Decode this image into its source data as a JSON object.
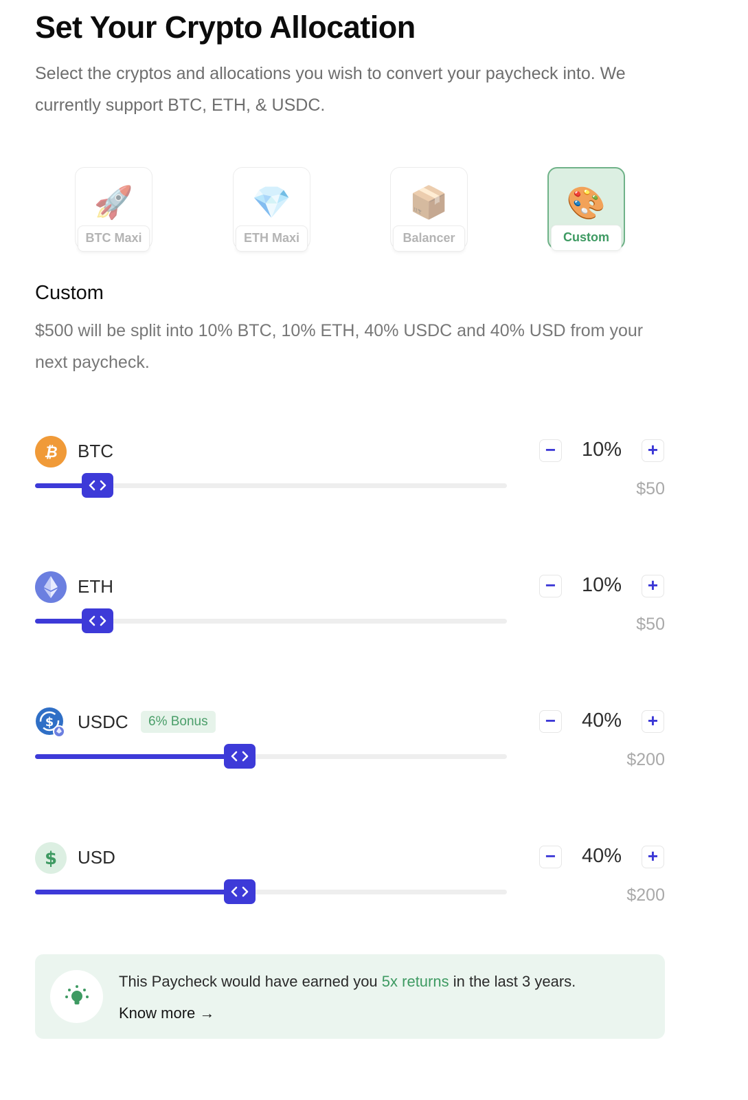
{
  "header": {
    "title": "Set Your Crypto Allocation",
    "subtitle": "Select the cryptos and allocations you wish to convert your paycheck into. We currently support BTC, ETH, & USDC."
  },
  "presets": [
    {
      "label": "BTC Maxi",
      "icon": "rocket-icon",
      "glyph": "🚀",
      "selected": false
    },
    {
      "label": "ETH Maxi",
      "icon": "gem-icon",
      "glyph": "💎",
      "selected": false
    },
    {
      "label": "Balancer",
      "icon": "package-icon",
      "glyph": "📦",
      "selected": false
    },
    {
      "label": "Custom",
      "icon": "palette-icon",
      "glyph": "🎨",
      "selected": true
    }
  ],
  "selection": {
    "title": "Custom",
    "description": "$500 will be split into 10% BTC, 10% ETH, 40% USDC and 40% USD from your next paycheck."
  },
  "assets": [
    {
      "name": "BTC",
      "icon": "bitcoin-icon",
      "percent": 10,
      "percent_label": "10%",
      "amount": "$50",
      "badge": null
    },
    {
      "name": "ETH",
      "icon": "ethereum-icon",
      "percent": 10,
      "percent_label": "10%",
      "amount": "$50",
      "badge": null
    },
    {
      "name": "USDC",
      "icon": "usdc-icon",
      "percent": 40,
      "percent_label": "40%",
      "amount": "$200",
      "badge": "6% Bonus"
    },
    {
      "name": "USD",
      "icon": "dollar-icon",
      "percent": 40,
      "percent_label": "40%",
      "amount": "$200",
      "badge": null
    }
  ],
  "stepper": {
    "minus": "−",
    "plus": "+"
  },
  "info": {
    "text_before": "This Paycheck would have earned you ",
    "highlight": "5x returns",
    "text_after": " in the last 3 years.",
    "link": "Know more →",
    "icon": "lightbulb-icon"
  },
  "colors": {
    "accent": "#3d3ad8",
    "success": "#3e9a62",
    "btc": "#f09a38",
    "eth": "#6b7fe0",
    "usdc": "#2f6fc6",
    "usd_bg": "#dcefe2"
  }
}
